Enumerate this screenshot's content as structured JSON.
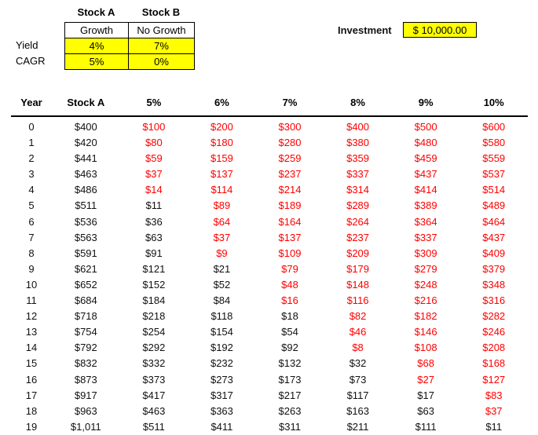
{
  "assumptions": {
    "col_headers": [
      "Stock A",
      "Stock B"
    ],
    "growth_row": [
      "Growth",
      "No Growth"
    ],
    "row_labels": [
      "Yield",
      "CAGR"
    ],
    "yield_values": [
      "4%",
      "7%"
    ],
    "cagr_values": [
      "5%",
      "0%"
    ],
    "highlight_color": "#ffff00"
  },
  "investment": {
    "label": "Investment",
    "value": "$ 10,000.00",
    "highlight_color": "#ffff00"
  },
  "table": {
    "headers": [
      "Year",
      "Stock A",
      "5%",
      "6%",
      "7%",
      "8%",
      "9%",
      "10%"
    ],
    "negative_color": "#ff0000",
    "rows": [
      {
        "year": "0",
        "cells": [
          "$400",
          "$100",
          "$200",
          "$300",
          "$400",
          "$500",
          "$600"
        ],
        "neg": [
          true,
          true,
          true,
          true,
          true,
          true
        ]
      },
      {
        "year": "1",
        "cells": [
          "$420",
          "$80",
          "$180",
          "$280",
          "$380",
          "$480",
          "$580"
        ],
        "neg": [
          true,
          true,
          true,
          true,
          true,
          true
        ]
      },
      {
        "year": "2",
        "cells": [
          "$441",
          "$59",
          "$159",
          "$259",
          "$359",
          "$459",
          "$559"
        ],
        "neg": [
          true,
          true,
          true,
          true,
          true,
          true
        ]
      },
      {
        "year": "3",
        "cells": [
          "$463",
          "$37",
          "$137",
          "$237",
          "$337",
          "$437",
          "$537"
        ],
        "neg": [
          true,
          true,
          true,
          true,
          true,
          true
        ]
      },
      {
        "year": "4",
        "cells": [
          "$486",
          "$14",
          "$114",
          "$214",
          "$314",
          "$414",
          "$514"
        ],
        "neg": [
          true,
          true,
          true,
          true,
          true,
          true
        ]
      },
      {
        "year": "5",
        "cells": [
          "$511",
          "$11",
          "$89",
          "$189",
          "$289",
          "$389",
          "$489"
        ],
        "neg": [
          false,
          true,
          true,
          true,
          true,
          true
        ]
      },
      {
        "year": "6",
        "cells": [
          "$536",
          "$36",
          "$64",
          "$164",
          "$264",
          "$364",
          "$464"
        ],
        "neg": [
          false,
          true,
          true,
          true,
          true,
          true
        ]
      },
      {
        "year": "7",
        "cells": [
          "$563",
          "$63",
          "$37",
          "$137",
          "$237",
          "$337",
          "$437"
        ],
        "neg": [
          false,
          true,
          true,
          true,
          true,
          true
        ]
      },
      {
        "year": "8",
        "cells": [
          "$591",
          "$91",
          "$9",
          "$109",
          "$209",
          "$309",
          "$409"
        ],
        "neg": [
          false,
          true,
          true,
          true,
          true,
          true
        ]
      },
      {
        "year": "9",
        "cells": [
          "$621",
          "$121",
          "$21",
          "$79",
          "$179",
          "$279",
          "$379"
        ],
        "neg": [
          false,
          false,
          true,
          true,
          true,
          true
        ]
      },
      {
        "year": "10",
        "cells": [
          "$652",
          "$152",
          "$52",
          "$48",
          "$148",
          "$248",
          "$348"
        ],
        "neg": [
          false,
          false,
          true,
          true,
          true,
          true
        ]
      },
      {
        "year": "11",
        "cells": [
          "$684",
          "$184",
          "$84",
          "$16",
          "$116",
          "$216",
          "$316"
        ],
        "neg": [
          false,
          false,
          true,
          true,
          true,
          true
        ]
      },
      {
        "year": "12",
        "cells": [
          "$718",
          "$218",
          "$118",
          "$18",
          "$82",
          "$182",
          "$282"
        ],
        "neg": [
          false,
          false,
          false,
          true,
          true,
          true
        ]
      },
      {
        "year": "13",
        "cells": [
          "$754",
          "$254",
          "$154",
          "$54",
          "$46",
          "$146",
          "$246"
        ],
        "neg": [
          false,
          false,
          false,
          true,
          true,
          true
        ]
      },
      {
        "year": "14",
        "cells": [
          "$792",
          "$292",
          "$192",
          "$92",
          "$8",
          "$108",
          "$208"
        ],
        "neg": [
          false,
          false,
          false,
          true,
          true,
          true
        ]
      },
      {
        "year": "15",
        "cells": [
          "$832",
          "$332",
          "$232",
          "$132",
          "$32",
          "$68",
          "$168"
        ],
        "neg": [
          false,
          false,
          false,
          false,
          true,
          true
        ]
      },
      {
        "year": "16",
        "cells": [
          "$873",
          "$373",
          "$273",
          "$173",
          "$73",
          "$27",
          "$127"
        ],
        "neg": [
          false,
          false,
          false,
          false,
          true,
          true
        ]
      },
      {
        "year": "17",
        "cells": [
          "$917",
          "$417",
          "$317",
          "$217",
          "$117",
          "$17",
          "$83"
        ],
        "neg": [
          false,
          false,
          false,
          false,
          false,
          true
        ]
      },
      {
        "year": "18",
        "cells": [
          "$963",
          "$463",
          "$363",
          "$263",
          "$163",
          "$63",
          "$37"
        ],
        "neg": [
          false,
          false,
          false,
          false,
          false,
          true
        ]
      },
      {
        "year": "19",
        "cells": [
          "$1,011",
          "$511",
          "$411",
          "$311",
          "$211",
          "$111",
          "$11"
        ],
        "neg": [
          false,
          false,
          false,
          false,
          false,
          false
        ]
      }
    ]
  }
}
